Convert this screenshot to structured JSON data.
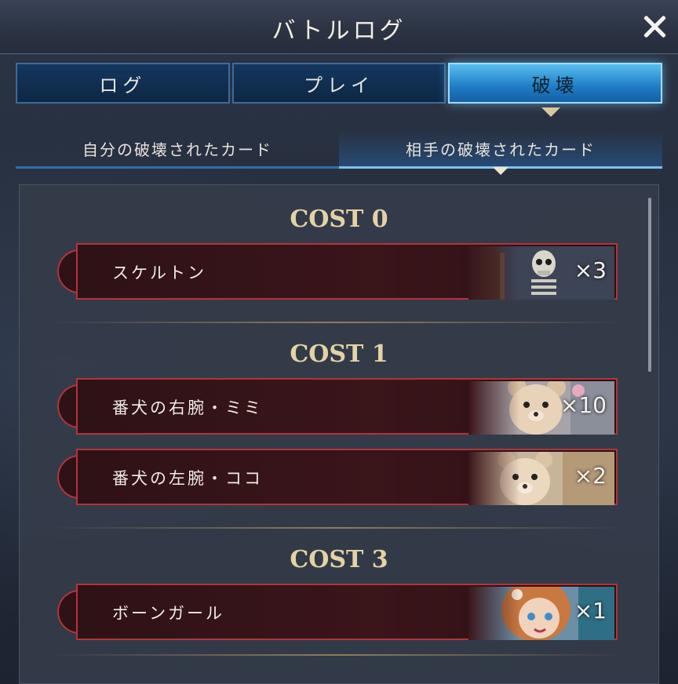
{
  "window": {
    "title": "バトルログ"
  },
  "tabs": [
    {
      "label": "ログ",
      "active": false
    },
    {
      "label": "プレイ",
      "active": false
    },
    {
      "label": "破壊",
      "active": true
    }
  ],
  "subtabs": [
    {
      "label": "自分の破壊されたカード",
      "active": false
    },
    {
      "label": "相手の破壊されたカード",
      "active": true
    }
  ],
  "groups": [
    {
      "heading": "COST 0",
      "cards": [
        {
          "name": "スケルトン",
          "count": "×3",
          "art": "skeleton-art"
        }
      ]
    },
    {
      "heading": "COST 1",
      "cards": [
        {
          "name": "番犬の右腕・ミミ",
          "count": "×10",
          "art": "bear-art"
        },
        {
          "name": "番犬の左腕・ココ",
          "count": "×2",
          "art": "bear-art"
        }
      ]
    },
    {
      "heading": "COST 3",
      "cards": [
        {
          "name": "ボーンガール",
          "count": "×1",
          "art": "girl-art"
        }
      ]
    }
  ],
  "colors": {
    "accent_tab": "#59bdf0",
    "card_border": "#b2353a",
    "cost_heading": "#e4d2a4"
  }
}
